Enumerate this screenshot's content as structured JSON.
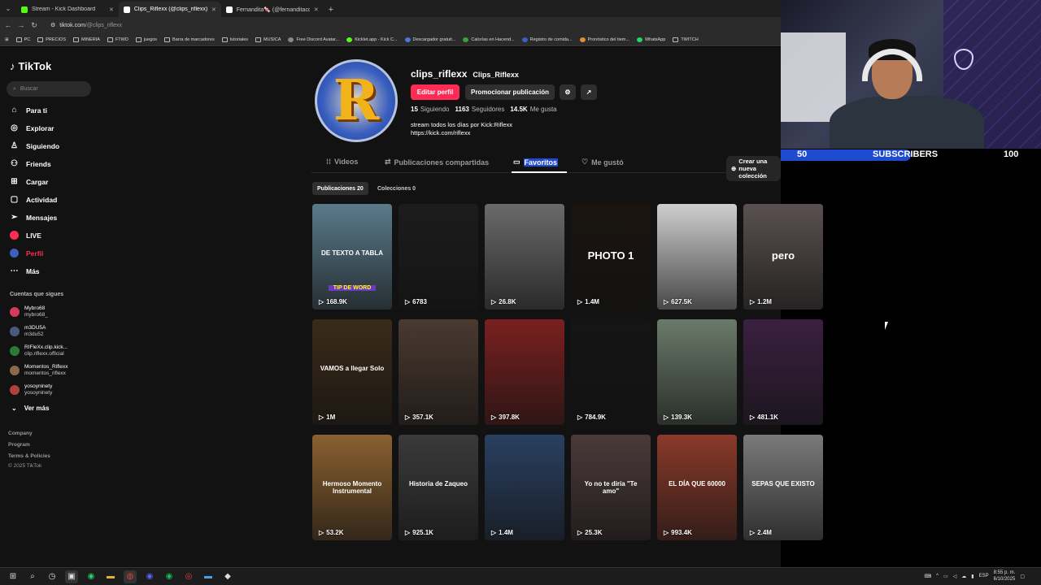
{
  "browser": {
    "tabs": [
      {
        "title": "Stream - Kick Dashboard",
        "color": "#53fc18",
        "active": false
      },
      {
        "title": "Clips_Riflexx (@clips_riflexx) | Ti",
        "color": "#ffffff",
        "active": true
      },
      {
        "title": "Fernandita🍬 (@fernanditacqs",
        "color": "#ffffff",
        "active": false
      }
    ],
    "url_host": "tiktok.com",
    "url_path": "/@clips_riflexx",
    "bookmarks": [
      {
        "label": "PC",
        "icon": "folder-icon"
      },
      {
        "label": "PRECIOS",
        "icon": "folder-icon"
      },
      {
        "label": "MINERIA",
        "icon": "folder-icon"
      },
      {
        "label": "FTWD",
        "icon": "folder-icon"
      },
      {
        "label": "juegos",
        "icon": "folder-icon"
      },
      {
        "label": "Barra de marcadores",
        "icon": "folder-icon"
      },
      {
        "label": "tutoriales",
        "icon": "folder-icon"
      },
      {
        "label": "MUSICA",
        "icon": "folder-icon"
      },
      {
        "label": "Free Discord Avatar...",
        "icon": "site-icon"
      },
      {
        "label": "Kicklet.app - Kick C...",
        "icon": "site-icon"
      },
      {
        "label": "Descargador gratuit...",
        "icon": "site-icon"
      },
      {
        "label": "Calorías en Hacend...",
        "icon": "site-icon"
      },
      {
        "label": "Registro de comida...",
        "icon": "site-icon"
      },
      {
        "label": "Pronóstico del tiem...",
        "icon": "site-icon"
      },
      {
        "label": "WhatsApp",
        "icon": "whatsapp-icon"
      },
      {
        "label": "TWITCH",
        "icon": "folder-icon"
      }
    ]
  },
  "sidebar": {
    "logo": "TikTok",
    "search_placeholder": "Buscar",
    "nav": [
      {
        "label": "Para ti",
        "icon": "home-icon"
      },
      {
        "label": "Explorar",
        "icon": "compass-icon"
      },
      {
        "label": "Siguiendo",
        "icon": "following-icon"
      },
      {
        "label": "Friends",
        "icon": "friends-icon"
      },
      {
        "label": "Cargar",
        "icon": "upload-icon"
      },
      {
        "label": "Actividad",
        "icon": "activity-icon"
      },
      {
        "label": "Mensajes",
        "icon": "messages-icon"
      },
      {
        "label": "LIVE",
        "icon": "live-icon"
      },
      {
        "label": "Perfil",
        "icon": "profile-icon"
      },
      {
        "label": "Más",
        "icon": "more-icon"
      }
    ],
    "following_title": "Cuentas que sigues",
    "following": [
      {
        "name": "Mybro68",
        "handle": "mybro68_",
        "color": "#d23c5a"
      },
      {
        "name": "m3DU5A",
        "handle": "m3du52",
        "color": "#4a5a7a"
      },
      {
        "name": "RIFleXx.clip.kick...",
        "handle": "clip.riflexx.official",
        "color": "#2a7a3a"
      },
      {
        "name": "Momentos_Riflexx",
        "handle": "momentos_riflexx",
        "color": "#8a6a4a"
      },
      {
        "name": "yosoyninety",
        "handle": "yosoyninety",
        "color": "#b04040"
      }
    ],
    "see_more": "Ver más",
    "footer": [
      "Company",
      "Program",
      "Terms & Policies",
      "© 2025 TikTok"
    ]
  },
  "profile": {
    "username": "clips_riflexx",
    "nickname": "Clips_Riflexx",
    "edit_button": "Editar perfil",
    "promote_button": "Promocionar publicación",
    "stats": [
      {
        "value": "15",
        "label": "Siguiendo"
      },
      {
        "value": "1163",
        "label": "Seguidores"
      },
      {
        "value": "14.5K",
        "label": "Me gusta"
      }
    ],
    "bio_line1": "stream todos los días por Kick:Riflexx",
    "bio_line2": "https://kick.com/riflexx",
    "tabs": [
      "Videos",
      "Publicaciones compartidas",
      "Favoritos",
      "Me gustó"
    ],
    "active_tab": "Favoritos",
    "new_collection": "Crear una nueva colección",
    "subtabs": [
      "Publicaciones 20",
      "Colecciones 0"
    ]
  },
  "videos": [
    {
      "views": "168.9K",
      "caption": "DE TEXTO A TABLA",
      "caption2": "TIP DE WORD",
      "bg": "#5a7a8a"
    },
    {
      "views": "6783",
      "caption": "",
      "bg": "#1c1c1c"
    },
    {
      "views": "26.8K",
      "caption": "",
      "bg": "#6a6a6a"
    },
    {
      "views": "1.4M",
      "caption": "PHOTO 1",
      "bg": "#1a1410"
    },
    {
      "views": "627.5K",
      "caption": "",
      "bg": "#cfcfcf"
    },
    {
      "views": "1.2M",
      "caption": "pero",
      "bg": "#5a5050"
    },
    {
      "views": "1M",
      "caption": "VAMOS a llegar Solo",
      "bg": "#3a2a1a"
    },
    {
      "views": "357.1K",
      "caption": "",
      "bg": "#4a3a30"
    },
    {
      "views": "397.8K",
      "caption": "",
      "bg": "#7a2020"
    },
    {
      "views": "784.9K",
      "caption": "",
      "bg": "#151515"
    },
    {
      "views": "139.3K",
      "caption": "",
      "bg": "#6a7a6a"
    },
    {
      "views": "481.1K",
      "caption": "",
      "bg": "#3a2040"
    },
    {
      "views": "53.2K",
      "caption": "Hermoso Momento Instrumental",
      "bg": "#8a6030"
    },
    {
      "views": "925.1K",
      "caption": "Historia de Zaqueo",
      "bg": "#3a3a3a"
    },
    {
      "views": "1.4M",
      "caption": "",
      "bg": "#2a4060"
    },
    {
      "views": "25.3K",
      "caption": "Yo no te diría \"Te amo\"",
      "bg": "#4a3a3a"
    },
    {
      "views": "993.4K",
      "caption": "EL DÍA QUE 60000",
      "bg": "#8a3a2a"
    },
    {
      "views": "2.4M",
      "caption": "SEPAS QUE EXISTO",
      "bg": "#7a7a7a"
    }
  ],
  "overlay": {
    "sub_current": "50",
    "sub_label": "SUBSCRIBERS",
    "sub_goal": "100",
    "progress": 0.5
  },
  "taskbar": {
    "lang": "ESP",
    "time": "8:55 p. m.",
    "date": "6/10/2025"
  }
}
